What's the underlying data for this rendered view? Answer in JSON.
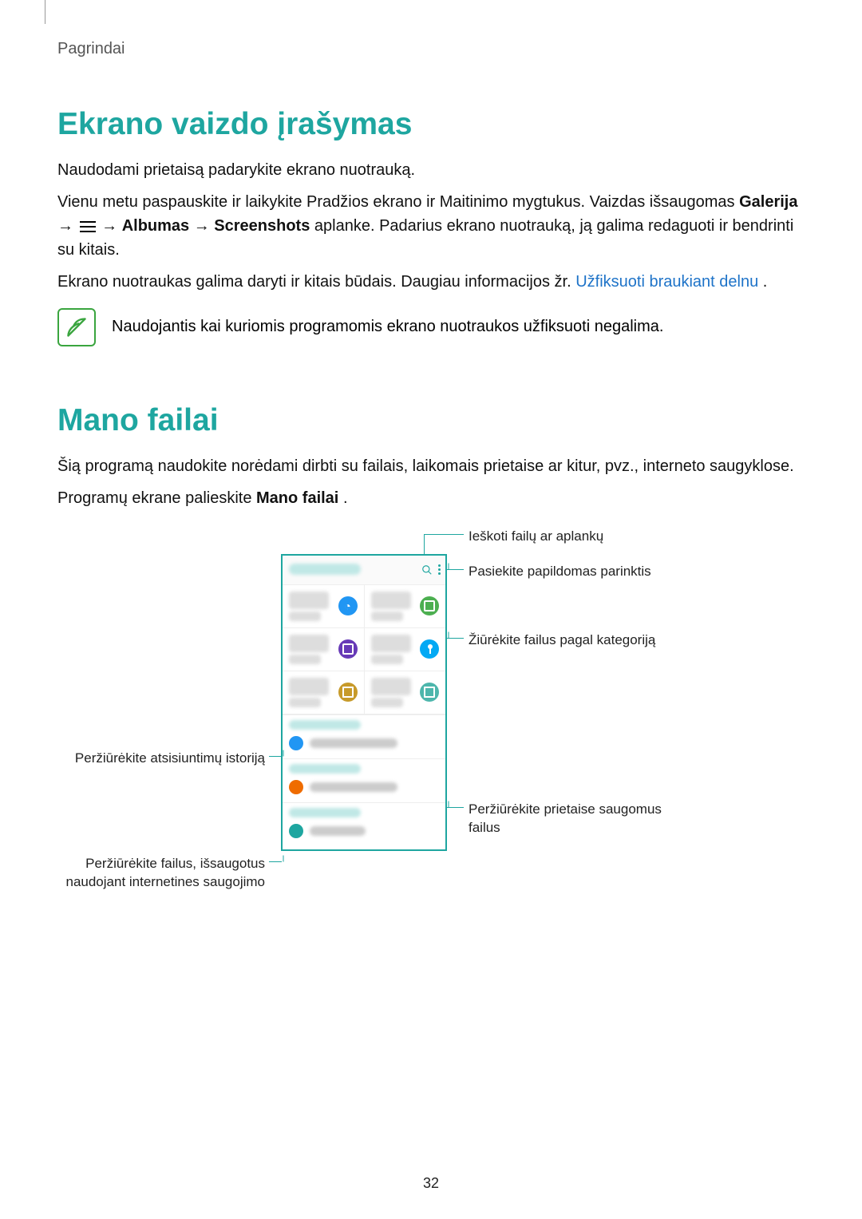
{
  "breadcrumb": "Pagrindai",
  "section1": {
    "title": "Ekrano vaizdo įrašymas",
    "p1": "Naudodami prietaisą padarykite ekrano nuotrauką.",
    "p2_pre": "Vienu metu paspauskite ir laikykite Pradžios ekrano ir Maitinimo mygtukus. Vaizdas išsaugomas ",
    "p2_bold1": "Galerija",
    "p2_arrow1": " → ",
    "p2_arrow2": " → ",
    "p2_bold2": "Albumas",
    "p2_arrow3": " → ",
    "p2_bold3": "Screenshots",
    "p2_post": " aplanke. Padarius ekrano nuotrauką, ją galima redaguoti ir bendrinti su kitais.",
    "p3_pre": "Ekrano nuotraukas galima daryti ir kitais būdais. Daugiau informacijos žr. ",
    "p3_link": "Užfiksuoti braukiant delnu",
    "p3_post": ".",
    "note": "Naudojantis kai kuriomis programomis ekrano nuotraukos užfiksuoti negalima."
  },
  "section2": {
    "title": "Mano failai",
    "p1": "Šią programą naudokite norėdami dirbti su failais, laikomais prietaise ar kitur, pvz., interneto saugyklose.",
    "p2_pre": "Programų ekrane palieskite ",
    "p2_bold": "Mano failai",
    "p2_post": "."
  },
  "callouts": {
    "c_search": "Ieškoti failų ar aplankų",
    "c_options": "Pasiekite papildomas parinktis",
    "c_category": "Žiūrėkite failus pagal kategoriją",
    "c_downloads": "Peržiūrėkite atsisiuntimų istoriją",
    "c_device_l1": "Peržiūrėkite prietaise saugomus",
    "c_device_l2": "failus",
    "c_cloud_l1": "Peržiūrėkite failus, išsaugotus",
    "c_cloud_l2": "naudojant internetines saugojimo"
  },
  "page_number": "32"
}
